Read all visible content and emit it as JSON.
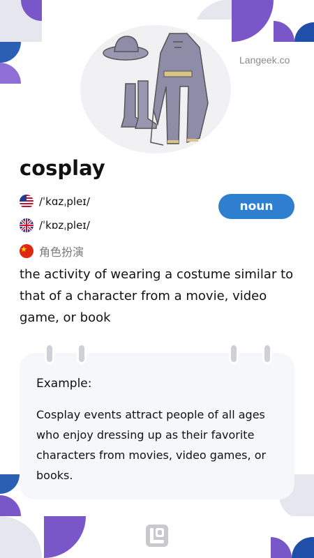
{
  "watermark": "Langeek.co",
  "word": "cosplay",
  "pronunciations": [
    {
      "flag": "us-flag-icon",
      "ipa": "/ˈkɑzˌpleɪ/"
    },
    {
      "flag": "uk-flag-icon",
      "ipa": "/ˈkɒzˌpleɪ/"
    }
  ],
  "translation": {
    "flag": "china-flag-icon",
    "text": "角色扮演"
  },
  "part_of_speech": "noun",
  "definition": "the activity of wearing a costume similar to that of a character from a movie, video game, or book",
  "example": {
    "label": "Example:",
    "text": "Cosplay events attract people of all ages who enjoy dressing up as their favorite characters from movies, video games, or books."
  },
  "illustration": "costume-illustration",
  "colors": {
    "accent_purple": "#7a57c8",
    "accent_blue": "#2f7fd0",
    "deco_gray": "#e5e6ee",
    "card_bg": "#f6f7fb"
  }
}
